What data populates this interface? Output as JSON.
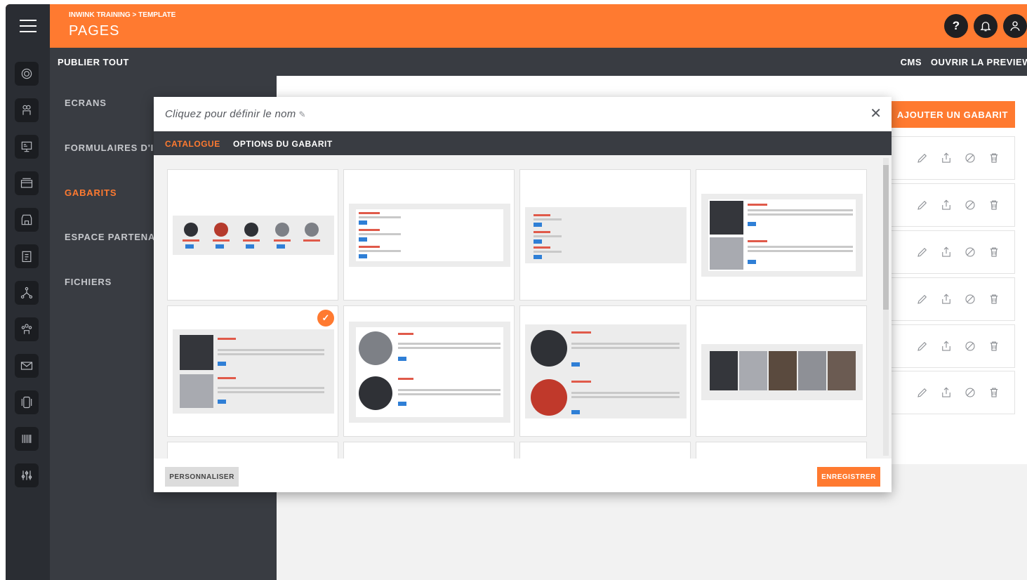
{
  "header": {
    "breadcrumb": "INWINK TRAINING > TEMPLATE",
    "title": "PAGES",
    "help_icon": "question-icon",
    "bell_icon": "bell-icon",
    "user_icon": "user-icon",
    "help_glyph": "?",
    "bell_glyph": "🔔",
    "user_glyph": "👤"
  },
  "actionbar": {
    "publish_all": "PUBLIER TOUT",
    "cms": "CMS",
    "preview": "OUVRIR LA PREVIEW"
  },
  "menu": {
    "items": [
      {
        "label": "ECRANS"
      },
      {
        "label": "FORMULAIRES D'IN"
      },
      {
        "label": "GABARITS",
        "active": true
      },
      {
        "label": "ESPACE PARTENAIR"
      },
      {
        "label": "FICHIERS"
      }
    ],
    "chevron": "›"
  },
  "content": {
    "add_template": "AJOUTER UN GABARIT"
  },
  "modal": {
    "name_placeholder": "Cliquez pour définir le nom",
    "pen_glyph": "✎",
    "close_glyph": "✕",
    "tabs": [
      "CATALOGUE",
      "OPTIONS DU GABARIT"
    ],
    "active_tab": "CATALOGUE",
    "selected_glyph": "✓",
    "customize": "PERSONNALISER",
    "save": "ENREGISTRER"
  },
  "colors": {
    "accent": "#ff7a30",
    "dark": "#2a2d33",
    "panel": "#393c42"
  }
}
